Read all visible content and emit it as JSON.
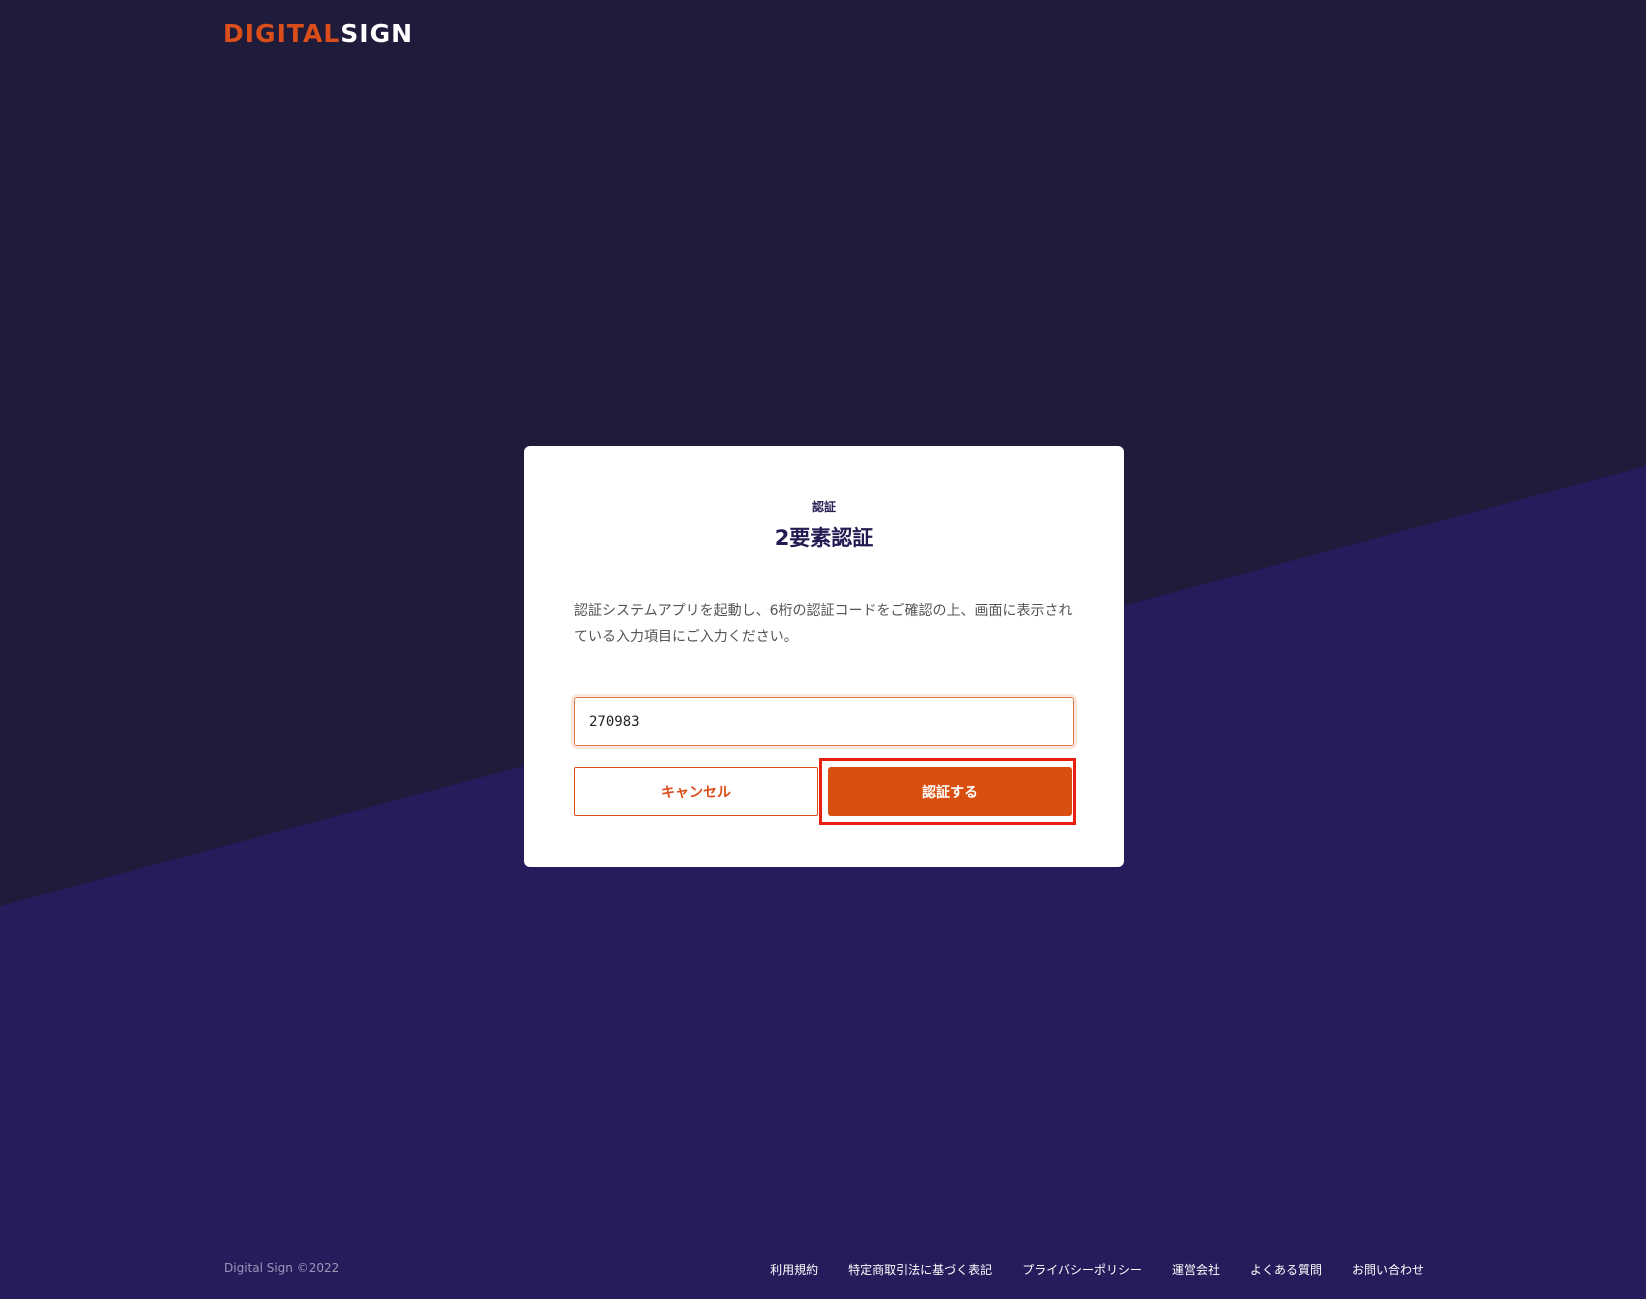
{
  "header": {
    "logo_part1": "DIGITAL",
    "logo_part2": "SIGN"
  },
  "card": {
    "eyebrow": "認証",
    "title": "2要素認証",
    "instructions": "認証システムアプリを起動し、6桁の認証コードをご確認の上、画面に表示されている入力項目にご入力ください。",
    "code_value": "270983",
    "cancel_label": "キャンセル",
    "submit_label": "認証する"
  },
  "footer": {
    "copyright": "Digital Sign ©2022",
    "links": [
      "利用規約",
      "特定商取引法に基づく表記",
      "プライバシーポリシー",
      "運営会社",
      "よくある質問",
      "お問い合わせ"
    ]
  },
  "colors": {
    "bg_dark": "#1f1b3a",
    "bg_purple": "#271b5b",
    "accent": "#d84f10",
    "highlight": "#e8200f"
  }
}
